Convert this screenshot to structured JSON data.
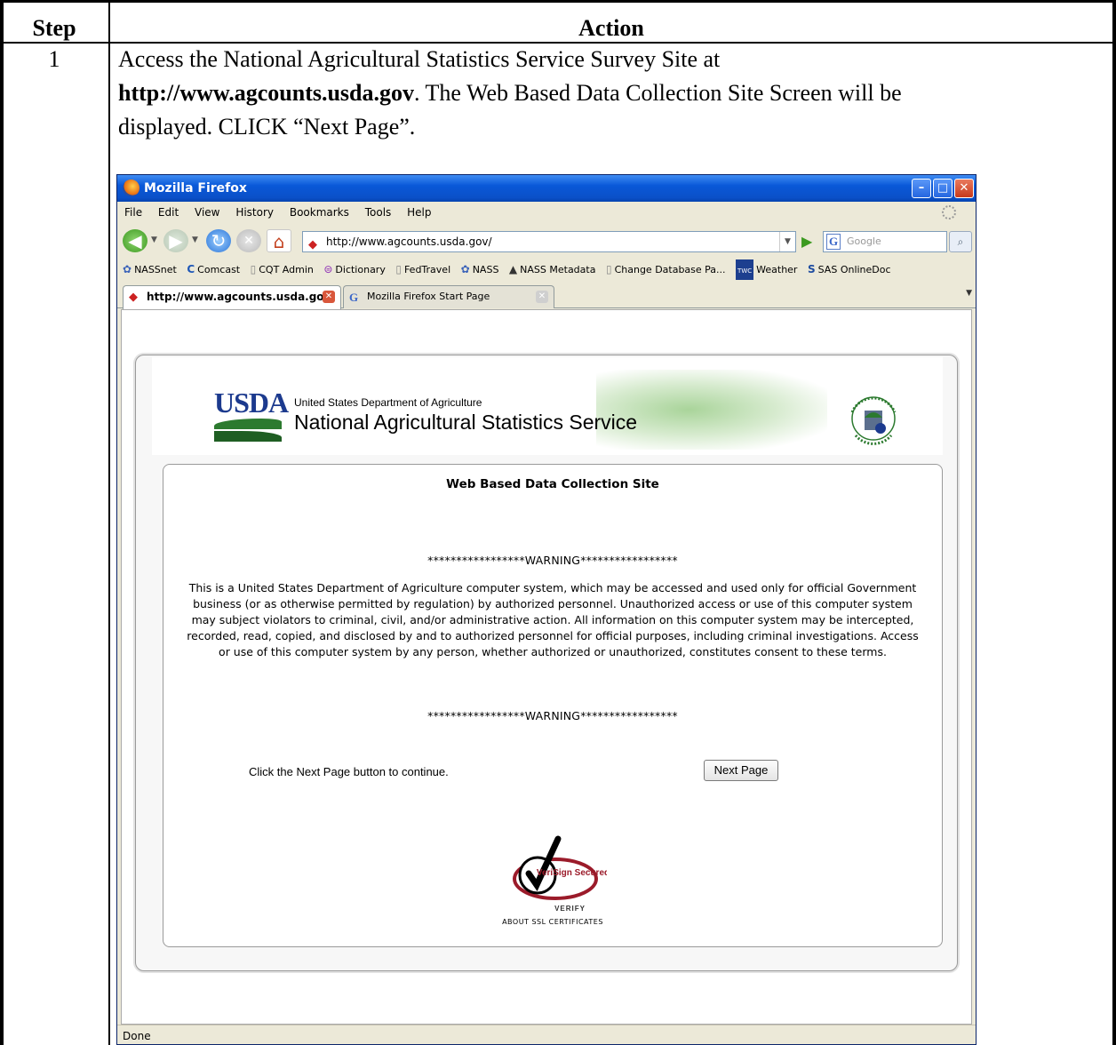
{
  "document": {
    "header_step": "Step",
    "header_action": "Action",
    "step_number": "1",
    "instruction_part1": "Access the National Agricultural Statistics Service Survey Site at",
    "instruction_url": "http://www.agcounts.usda.gov",
    "instruction_part2": ".  The Web Based Data Collection Site Screen will be",
    "instruction_part3": "displayed.  CLICK “Next Page”."
  },
  "browser": {
    "window_title": "Mozilla Firefox",
    "menus": [
      "File",
      "Edit",
      "View",
      "History",
      "Bookmarks",
      "Tools",
      "Help"
    ],
    "address": "http://www.agcounts.usda.gov/",
    "search_placeholder": "Google",
    "bookmarks": [
      "NASSnet",
      "Comcast",
      "CQT Admin",
      "Dictionary",
      "FedTravel",
      "NASS",
      "NASS Metadata",
      "Change Database Pa...",
      "Weather",
      "SAS OnlineDoc"
    ],
    "tabs": [
      "http://www.agcounts.usda.gov/",
      "Mozilla Firefox Start Page"
    ],
    "status": "Done"
  },
  "page": {
    "dept_name": "United States Department of Agriculture",
    "agency_name": "National Agricultural Statistics Service",
    "usda_logo_text": "USDA",
    "site_title": "Web Based Data Collection Site",
    "warning_banner": "*****************WARNING*****************",
    "warning_text": "This is a United States Department of Agriculture computer system, which may be accessed and used only for official Government business (or as otherwise permitted by regulation) by authorized personnel. Unauthorized access or use of this computer system may subject violators to criminal, civil, and/or administrative action. All information on this computer system may be intercepted, recorded, read, copied, and disclosed by and to authorized personnel for official purposes, including criminal investigations. Access or use of this computer system by any person, whether authorized or unauthorized, constitutes consent to these terms.",
    "continue_text": "Click the Next Page button to continue.",
    "next_button": "Next Page",
    "verisign_text": "VeriSign Secured",
    "verify_text": "VERIFY",
    "about_ssl": "ABOUT SSL CERTIFICATES"
  },
  "colors": {
    "titlebar": "#0a50c8",
    "usda_blue": "#1c3a8e",
    "usda_green": "#2c7a2f",
    "verisign_red": "#9b1b2a"
  }
}
